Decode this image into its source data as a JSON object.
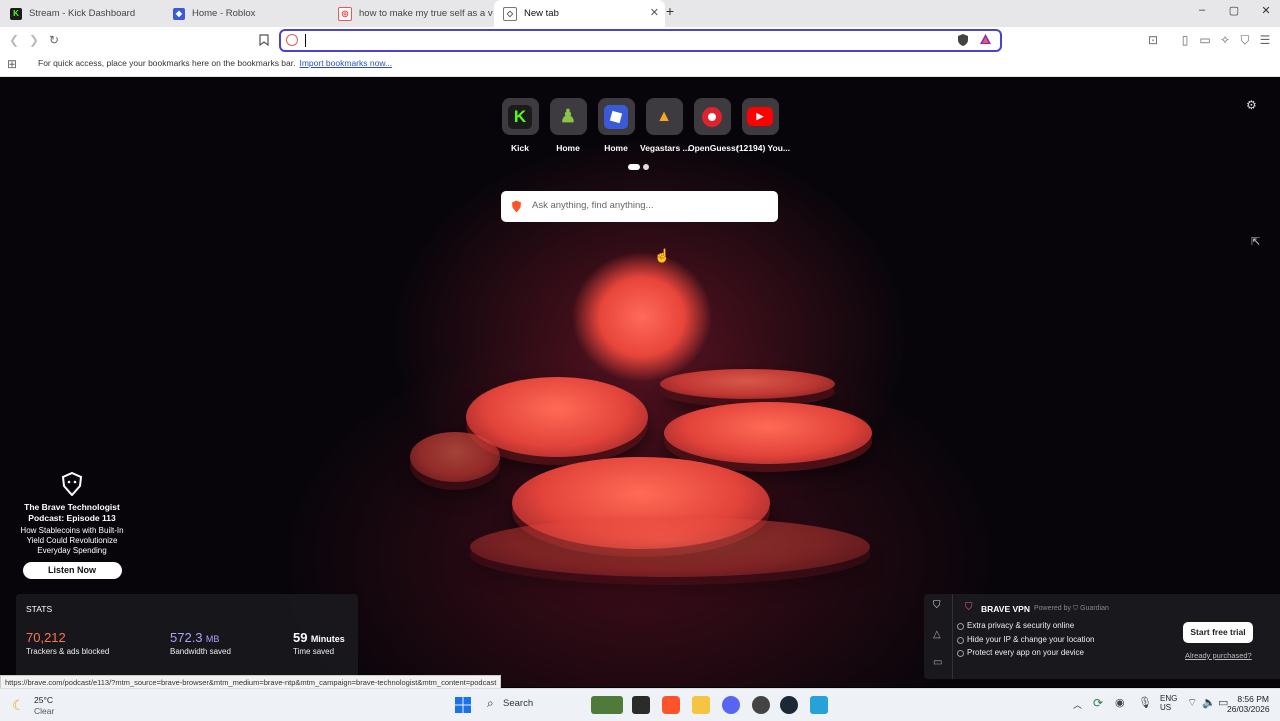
{
  "tabs": [
    {
      "label": "Stream - Kick Dashboard",
      "icon": "kick-icon"
    },
    {
      "label": "Home - Roblox",
      "icon": "roblox-icon"
    },
    {
      "label": "how to make my true self as a vtuber",
      "icon": "brave-search-icon"
    },
    {
      "label": "New tab",
      "icon": "brave-icon"
    }
  ],
  "window": {
    "minimize": "–",
    "maximize": "▢",
    "close": "✕"
  },
  "bookmarks_bar": {
    "text": "For quick access, place your bookmarks here on the bookmarks bar.",
    "link": "Import bookmarks now..."
  },
  "top_sites": [
    {
      "label": "Kick"
    },
    {
      "label": "Home"
    },
    {
      "label": "Home"
    },
    {
      "label": "Vegastars ..."
    },
    {
      "label": "OpenGuessr"
    },
    {
      "label": "(12194) You..."
    }
  ],
  "search": {
    "placeholder": "Ask anything, find anything..."
  },
  "promo": {
    "title": "The Brave Technologist Podcast: Episode 113",
    "subtitle": "How Stablecoins with Built-In Yield Could Revolutionize Everyday Spending",
    "button": "Listen Now"
  },
  "stats": {
    "heading": "STATS",
    "trackers": {
      "value": "70,212",
      "label": "Trackers & ads blocked"
    },
    "bandwidth": {
      "value": "572.3",
      "unit": "MB",
      "label": "Bandwidth saved"
    },
    "time": {
      "value": "59",
      "unit": "Minutes",
      "label": "Time saved"
    }
  },
  "vpn": {
    "title": "BRAVE VPN",
    "powered": "Powered by",
    "guardian": "Guardian",
    "features": [
      "Extra privacy & security online",
      "Hide your IP & change your location",
      "Protect every app on your device"
    ],
    "trial_button": "Start free trial",
    "purchased_link": "Already purchased?"
  },
  "status_url": "https://brave.com/podcast/e113/?mtm_source=brave-browser&mtm_medium=brave-ntp&mtm_campaign=brave-technologist&mtm_content=podcast",
  "taskbar": {
    "weather_temp": "25°C",
    "weather_desc": "Clear",
    "search": "Search",
    "lang1": "ENG",
    "lang2": "US",
    "time": "8:56 PM",
    "date": "26/03/2026"
  },
  "colors": {
    "accent": "#4a43d1",
    "kick": "#53fc18",
    "brave": "#fb542b",
    "stat_trackers": "#fb7451",
    "stat_bandwidth": "#a8a2ff"
  }
}
